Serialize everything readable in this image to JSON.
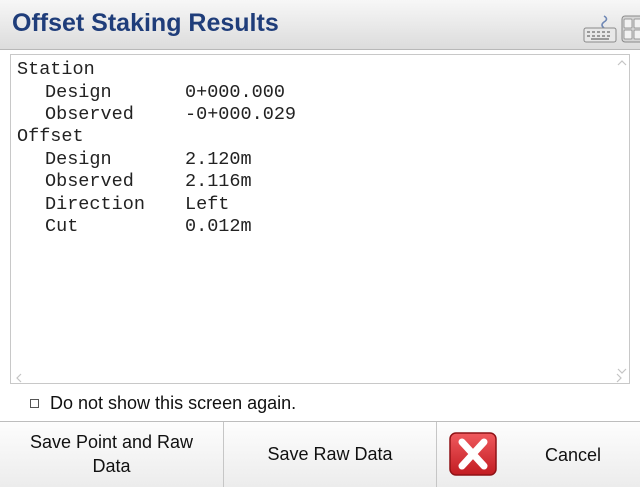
{
  "window": {
    "title": "Offset Staking Results"
  },
  "results": {
    "station_label": "Station",
    "station_design_label": "Design",
    "station_design_value": "0+000.000",
    "station_observed_label": "Observed",
    "station_observed_value": "-0+000.029",
    "offset_label": "Offset",
    "offset_design_label": "Design",
    "offset_design_value": "2.120m",
    "offset_observed_label": "Observed",
    "offset_observed_value": "2.116m",
    "direction_label": "Direction",
    "direction_value": "Left",
    "cut_label": "Cut",
    "cut_value": "0.012m"
  },
  "options": {
    "dont_show_label": "Do not show this screen again.",
    "dont_show_checked": false
  },
  "buttons": {
    "save_point_raw": "Save Point and Raw Data",
    "save_raw": "Save Raw Data",
    "cancel": "Cancel"
  },
  "icons": {
    "keyboard": "keyboard-icon",
    "calculator": "calculator-icon",
    "cancel": "red-x-icon"
  },
  "colors": {
    "title_text": "#1f3d7a",
    "cancel_red": "#d9262b"
  }
}
